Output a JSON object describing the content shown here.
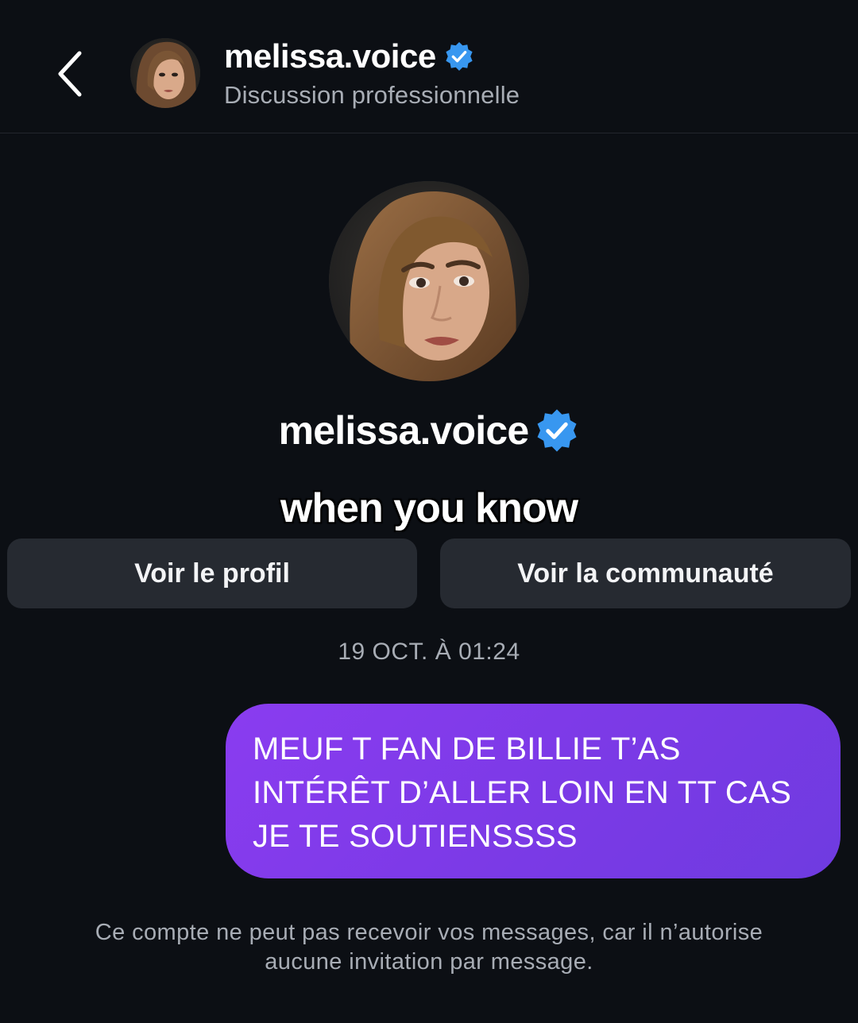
{
  "header": {
    "username": "melissa.voice",
    "subtitle": "Discussion professionnelle"
  },
  "profile": {
    "username": "melissa.voice"
  },
  "overlay": {
    "caption": "when you know"
  },
  "actions": {
    "view_profile": "Voir le profil",
    "view_community": "Voir la communauté"
  },
  "chat": {
    "timestamp": "19 OCT. À 01:24",
    "messages": [
      {
        "from": "me",
        "text": "MEUF T FAN DE BILLIE T’AS\nINTÉRÊT D’ALLER LOIN EN TT CAS\nJE TE SOUTIENSSSS"
      }
    ],
    "notice": "Ce compte ne peut pas recevoir vos messages, car il n’autorise aucune invitation par message."
  },
  "colors": {
    "background": "#0c0f14",
    "bubble": "#8a3cf0",
    "verified": "#3897f0",
    "button": "#262a31"
  },
  "icons": {
    "back": "chevron-left-icon",
    "verified": "verified-badge-icon"
  }
}
